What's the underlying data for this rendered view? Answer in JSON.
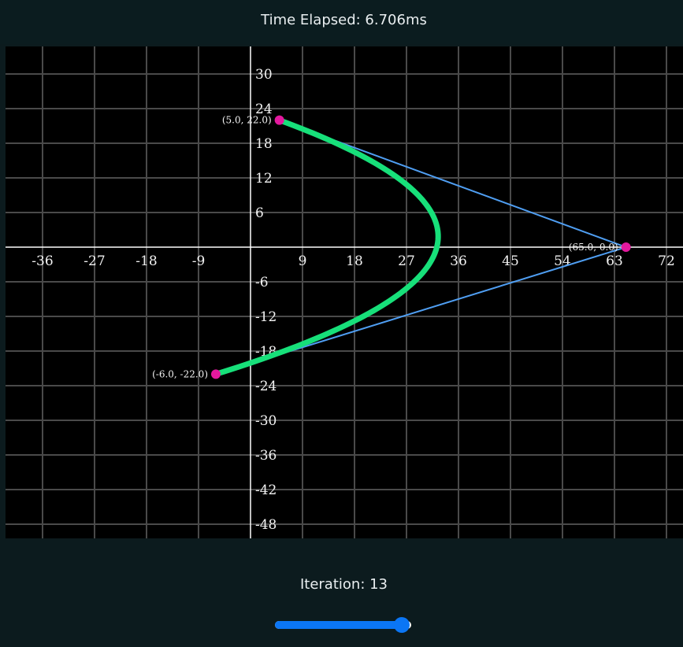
{
  "header": {
    "time_elapsed": "Time Elapsed: 6.706ms"
  },
  "footer": {
    "iteration_label": "Iteration: 13",
    "slider": {
      "value": 13,
      "min": 0,
      "max": 14
    }
  },
  "colors": {
    "page_background": "#0c1b1e",
    "canvas_background": "#000000",
    "grid": "#4a4a4a",
    "axis": "#ffffff",
    "curve": "#17e07a",
    "control_lines": "#4f9ef2",
    "points": "#e3199e",
    "slider": "#0b76f5"
  },
  "chart_data": {
    "type": "line",
    "title": "",
    "xlabel": "",
    "ylabel": "",
    "xlim": [
      -43,
      74
    ],
    "ylim": [
      -50.5,
      35
    ],
    "x_ticks": [
      -36,
      -27,
      -18,
      -9,
      9,
      18,
      27,
      36,
      45,
      54,
      63,
      72
    ],
    "y_ticks": [
      30,
      24,
      18,
      12,
      6,
      -6,
      -12,
      -18,
      -24,
      -30,
      -36,
      -42,
      -48
    ],
    "x_grid_spacing": 9,
    "y_grid_spacing": 6,
    "grid": true,
    "control_points": [
      {
        "label": "(5.0, 22.0)",
        "x": 5.0,
        "y": 22.0
      },
      {
        "label": "(65.0, 0.0)",
        "x": 65.0,
        "y": 0.0
      },
      {
        "label": "(-6.0, -22.0)",
        "x": -6.0,
        "y": -22.0
      }
    ],
    "series": [
      {
        "type": "quadratic_bezier",
        "control_point_indices": [
          0,
          1,
          2
        ]
      }
    ]
  }
}
